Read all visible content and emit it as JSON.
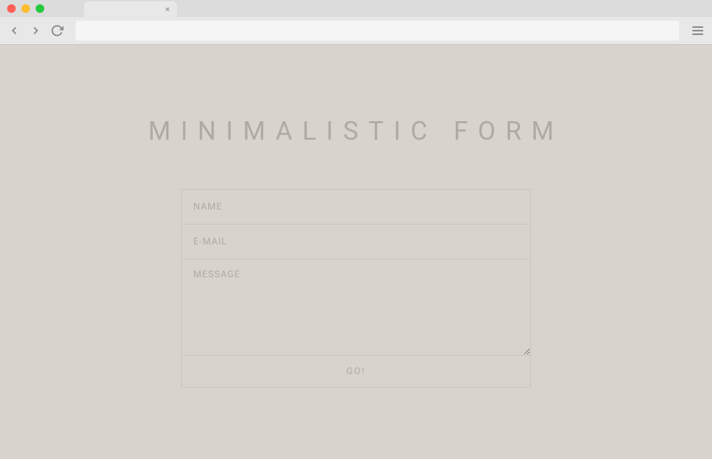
{
  "browser": {
    "tab_close": "×",
    "address_value": ""
  },
  "page": {
    "title": "MINIMALISTIC FORM"
  },
  "form": {
    "name_placeholder": "NAME",
    "name_value": "",
    "email_placeholder": "E-MAIL",
    "email_value": "",
    "message_placeholder": "MESSAGE",
    "message_value": "",
    "submit_label": "GO!"
  }
}
